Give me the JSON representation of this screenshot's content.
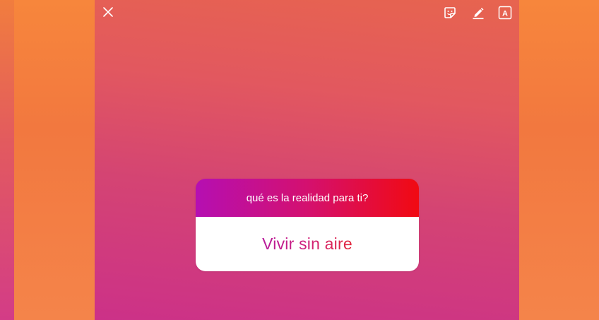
{
  "toolbar": {
    "close_icon": "close-icon",
    "sticker_icon": "sticker-icon",
    "draw_icon": "draw-icon",
    "text_icon": "text-icon",
    "text_icon_glyph": "A"
  },
  "question_sticker": {
    "question": "qué es la realidad para ti?",
    "answer": "Vivir sin aire"
  },
  "colors": {
    "background_top": "#f5843f",
    "story_bottom": "#cc3188",
    "sticker_gradient_start": "#b50fb2",
    "sticker_gradient_end": "#f10a12",
    "answer_text": "#d0207a"
  }
}
